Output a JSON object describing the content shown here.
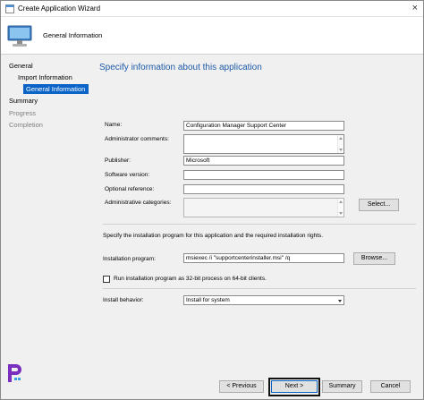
{
  "window": {
    "title": "Create Application Wizard",
    "close_glyph": "×",
    "app_icon": "wizard-app-icon",
    "header_icon": "computer-icon",
    "header_title": "General Information"
  },
  "sidebar": {
    "items": [
      {
        "label": "General",
        "state": "normal"
      },
      {
        "label": "Import Information",
        "state": "normal"
      },
      {
        "label": "General Information",
        "state": "selected"
      },
      {
        "label": "Summary",
        "state": "normal"
      },
      {
        "label": "Progress",
        "state": "disabled"
      },
      {
        "label": "Completion",
        "state": "disabled"
      }
    ]
  },
  "content": {
    "heading": "Specify information about this application",
    "fields": {
      "name": {
        "label": "Name:",
        "value": "Configuration Manager Support Center"
      },
      "admin_comments": {
        "label": "Administrator comments:",
        "value": ""
      },
      "publisher": {
        "label": "Publisher:",
        "value": "Microsoft"
      },
      "software_version": {
        "label": "Software version:",
        "value": ""
      },
      "optional_reference": {
        "label": "Optional reference:",
        "value": ""
      },
      "admin_categories": {
        "label": "Administrative categories:",
        "value": ""
      }
    },
    "select_button": "Select...",
    "install_instructions": "Specify the installation program for this application and the required installation rights.",
    "installation_program": {
      "label": "Installation program:",
      "value": "msiexec /i \"supportcenterinstaller.msi\" /q"
    },
    "browse_button": "Browse...",
    "checkbox_32bit": {
      "label": "Run installation program as 32-bit process on 64-bit clients.",
      "checked": false
    },
    "install_behavior": {
      "label": "Install behavior:",
      "value": "Install for system"
    }
  },
  "footer": {
    "previous": "< Previous",
    "next": "Next >",
    "summary": "Summary",
    "cancel": "Cancel"
  },
  "colors": {
    "accent": "#0a64c8",
    "heading": "#1e5aa8",
    "logo": "#7a2fbf"
  },
  "logo_icon": "brand-p-logo-icon"
}
